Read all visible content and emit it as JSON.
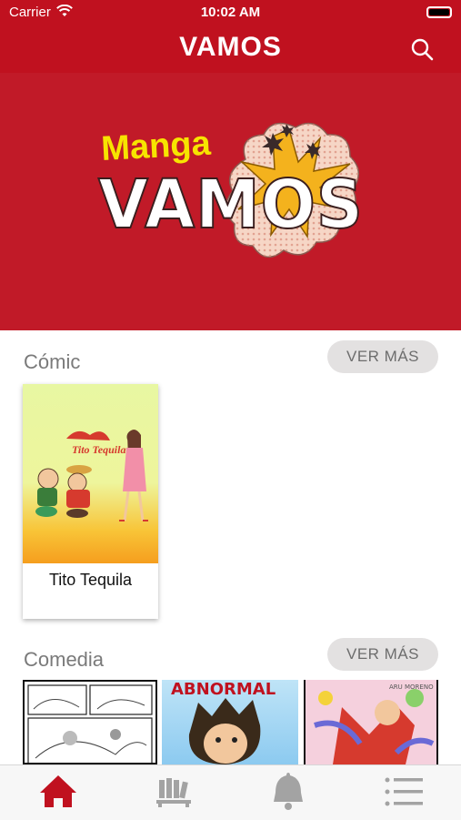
{
  "status_bar": {
    "carrier": "Carrier",
    "time": "10:02 AM"
  },
  "header": {
    "title": "VAMOS"
  },
  "hero": {
    "logo_small": "Manga",
    "logo_big": "VAMOS"
  },
  "sections": [
    {
      "title": "Cómic",
      "more_label": "VER MÁS",
      "items": [
        {
          "title": "Tito Tequila",
          "cover_text": "Tito Tequila"
        }
      ]
    },
    {
      "title": "Comedia",
      "more_label": "VER MÁS",
      "items": [
        {
          "cover_text": "ABNORMAL"
        },
        {
          "cover_text": "ARU MORENO"
        }
      ]
    }
  ],
  "tabs": [
    "home-icon",
    "library-icon",
    "bell-icon",
    "list-icon"
  ],
  "colors": {
    "brand_red": "#c0111f",
    "active_tab": "#c0111f",
    "inactive_tab": "#a3a3a3"
  }
}
